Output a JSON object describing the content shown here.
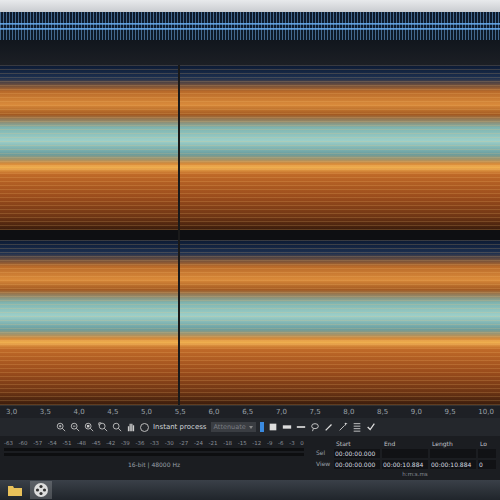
{
  "ruler": {
    "ticks": [
      "3,0",
      "3,5",
      "4,0",
      "4,5",
      "5,0",
      "5,5",
      "6,0",
      "6,5",
      "7,0",
      "7,5",
      "8,0",
      "8,5",
      "9,0",
      "9,5",
      "10,0"
    ]
  },
  "channels": [
    {
      "selected": false
    },
    {
      "selected": false
    }
  ],
  "playhead": {
    "level": 0.356
  },
  "toolbar": {
    "instant_process": {
      "label": "Instant process",
      "checked": false
    },
    "mode": {
      "value": "Attenuate",
      "disabled": true
    }
  },
  "meter": {
    "scale": [
      "-63",
      "-60",
      "-57",
      "-54",
      "-51",
      "-48",
      "-45",
      "-42",
      "-39",
      "-36",
      "-33",
      "-30",
      "-27",
      "-24",
      "-21",
      "-18",
      "-15",
      "-12",
      "-9",
      "-6",
      "-3",
      "0"
    ],
    "level": 0
  },
  "format": "16-bit | 48000 Hz",
  "selection_info": {
    "columns": [
      "Start",
      "End",
      "Length",
      "Lo"
    ],
    "rows": [
      {
        "label": "Sel",
        "values": [
          "00:00:00.000",
          "",
          "",
          ""
        ]
      },
      {
        "label": "View",
        "values": [
          "00:00:00.000",
          "00:00:10.884",
          "00:00:10.884",
          "0"
        ]
      }
    ],
    "unit": "h:m:s.ms"
  }
}
